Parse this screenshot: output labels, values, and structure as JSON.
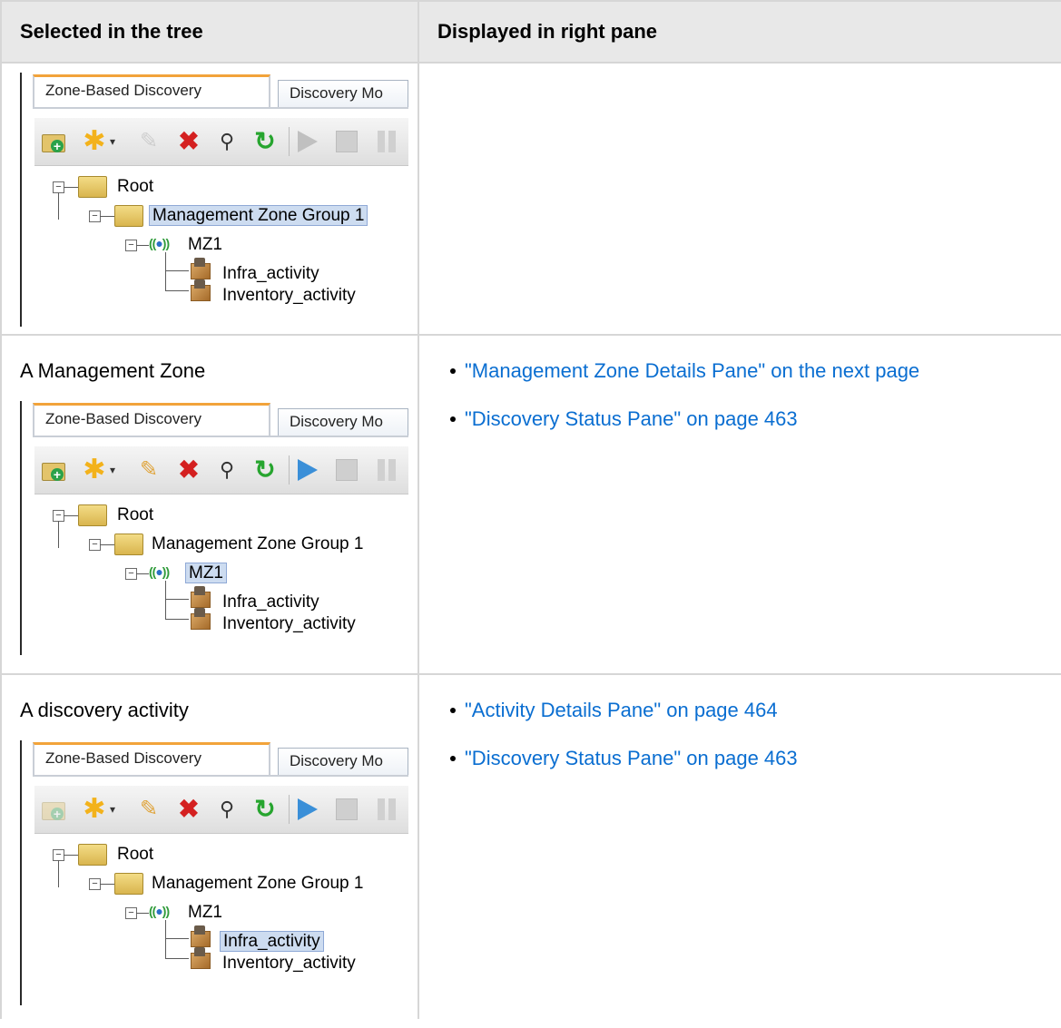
{
  "table": {
    "headers": [
      "Selected in the tree",
      "Displayed in right pane"
    ],
    "rows": [
      {
        "label": "",
        "links": []
      },
      {
        "label": "A Management Zone",
        "links": [
          "\"Management Zone Details Pane\" on the next page",
          "\"Discovery Status Pane\" on page 463"
        ]
      },
      {
        "label": "A discovery activity",
        "links": [
          "\"Activity Details Pane\" on page 464",
          "\"Discovery Status Pane\" on page 463"
        ]
      }
    ]
  },
  "widget": {
    "tab_active": "Zone-Based Discovery",
    "tab_inactive": "Discovery Mo",
    "tree": {
      "root": "Root",
      "group": "Management Zone Group 1",
      "zone": "MZ1",
      "activities": [
        "Infra_activity",
        "Inventory_activity"
      ]
    }
  },
  "icons": {
    "toolbar": [
      "new-folder-icon",
      "new-item-star-icon",
      "dropdown-caret-icon",
      "edit-pencil-icon",
      "delete-x-icon",
      "search-icon",
      "refresh-icon",
      "play-icon",
      "stop-icon",
      "pause-icon"
    ],
    "tree": [
      "collapse-icon",
      "folder-icon",
      "management-zone-icon",
      "activity-package-icon"
    ]
  },
  "colors": {
    "link": "#0a6ed1",
    "header_bg": "#e8e8e8",
    "selection": "#cddcf0",
    "tab_accent": "#f2a33a"
  }
}
